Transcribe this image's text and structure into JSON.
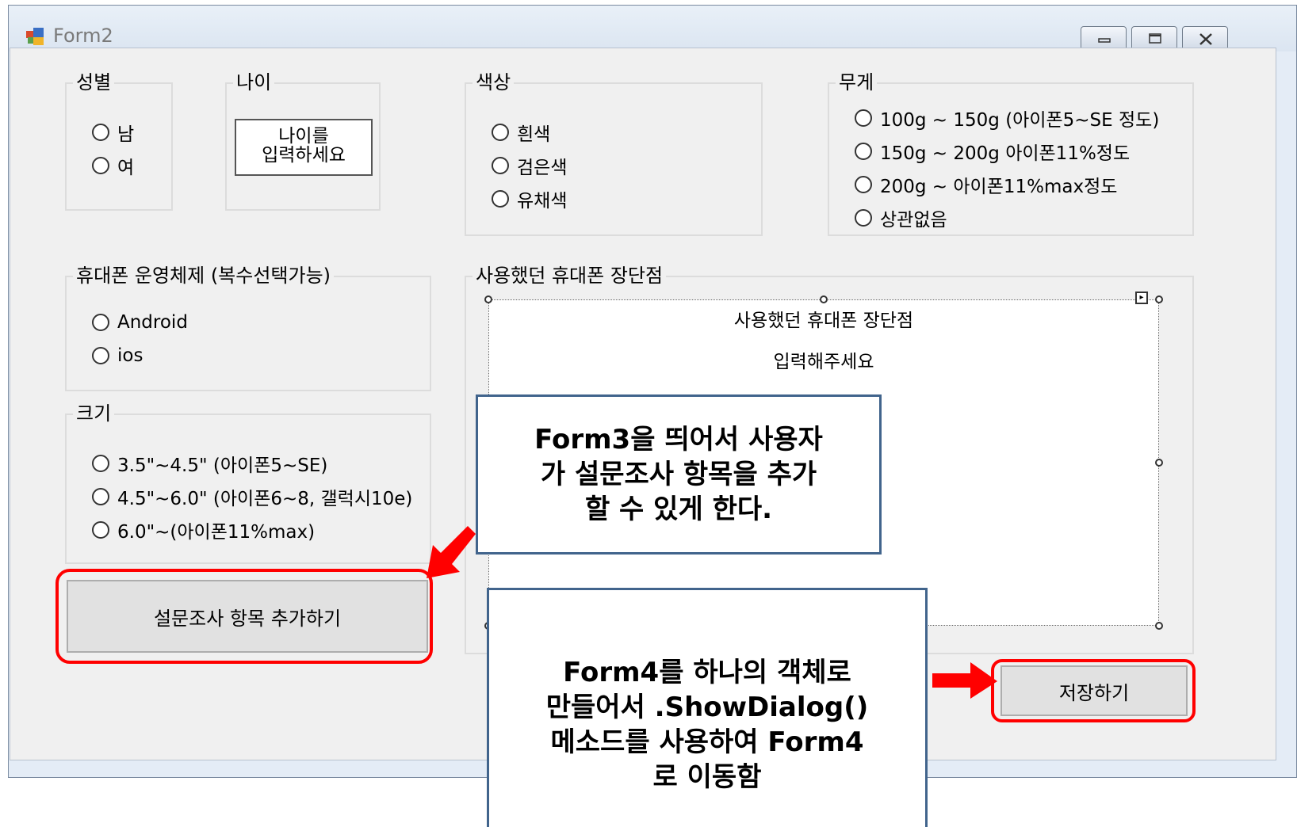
{
  "window": {
    "title": "Form2"
  },
  "gender": {
    "label": "성별",
    "options": [
      "남",
      "여"
    ]
  },
  "age": {
    "label": "나이",
    "placeholder_line1": "나이를",
    "placeholder_line2": "입력하세요"
  },
  "color": {
    "label": "색상",
    "options": [
      "흰색",
      "검은색",
      "유채색"
    ]
  },
  "weight": {
    "label": "무게",
    "options": [
      "100g ~ 150g (아이폰5~SE 정도)",
      "150g ~ 200g 아이폰11%정도",
      "200g ~ 아이폰11%max정도",
      "상관없음"
    ]
  },
  "os": {
    "label": "휴대폰 운영체제 (복수선택가능)",
    "options": [
      "Android",
      "ios"
    ]
  },
  "size": {
    "label": "크기",
    "options": [
      "3.5\"~4.5\" (아이폰5~SE)",
      "4.5\"~6.0\" (아이폰6~8, 갤럭시10e)",
      "6.0\"~(아이폰11%max)"
    ]
  },
  "pros_cons": {
    "label": "사용했던 휴대폰 장단점",
    "text_line1": "사용했던 휴대폰 장단점",
    "text_line2": "입력해주세요"
  },
  "buttons": {
    "add_item": "설문조사 항목 추가하기",
    "save": "저장하기"
  },
  "annotations": {
    "form3": [
      "Form3을 띄어서 사용자",
      "가 설문조사 항목을 추가",
      "할 수 있게 한다."
    ],
    "form4": [
      "Form4를 하나의 객체로",
      "만들어서 .ShowDialog()",
      "메소드를 사용하여 Form4",
      "로 이동함"
    ]
  },
  "colors": {
    "highlight": "#ff0000",
    "callout_border": "#41648c",
    "form_bg": "#f0f0f0"
  }
}
